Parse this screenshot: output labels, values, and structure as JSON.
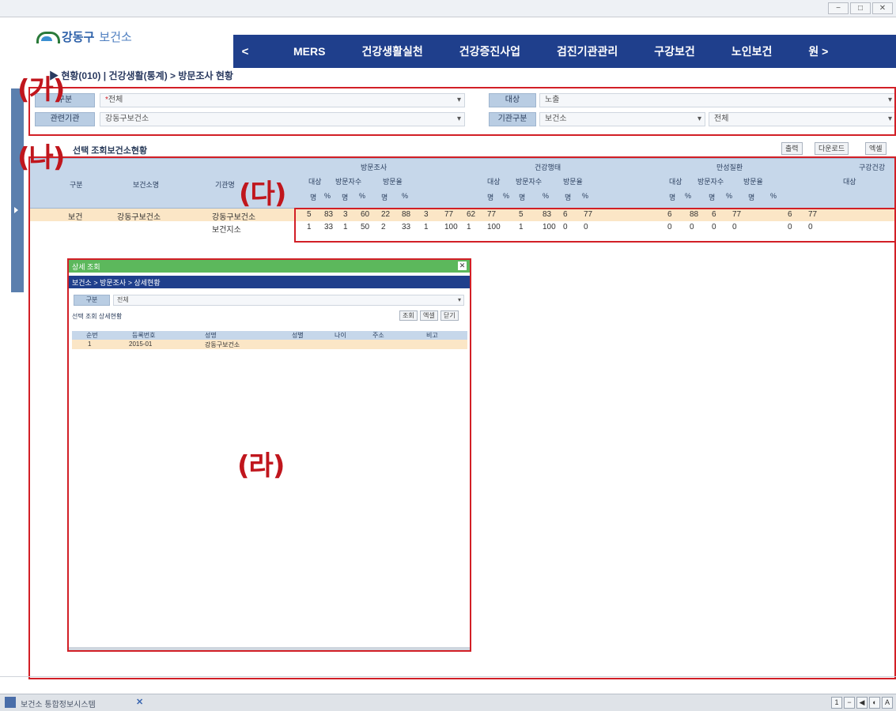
{
  "window": {
    "controls": [
      "−",
      "□",
      "✕"
    ]
  },
  "header": {
    "logo_text": "강동구",
    "logo_sub": "보건소",
    "nav_prev": "<",
    "nav_next": "원 >",
    "nav_items": [
      "MERS",
      "건강생활실천",
      "건강증진사업",
      "검진기관관리",
      "구강보건",
      "노인보건"
    ]
  },
  "breadcrumb": "▶ 현황(010) | 건강생활(통계) > 방문조사 현황",
  "annotations": {
    "ga": "(가)",
    "na": "(나)",
    "da": "(다)",
    "ra": "(라)"
  },
  "filter": {
    "row1": {
      "label1": "구분",
      "value1": "전체",
      "label2": "대상",
      "value2": "노출"
    },
    "row2": {
      "label1": "관련기관",
      "value1": "강동구보건소",
      "label2": "기관구분",
      "value2": "보건소",
      "value3": "전체"
    }
  },
  "toolbar": {
    "title": "선택 조회보건소현황",
    "buttons": [
      "출력",
      "다운로드",
      "엑셀"
    ]
  },
  "table": {
    "header_cols": [
      "구분",
      "보건소명",
      "기관명"
    ],
    "group_headers": [
      "방문조사",
      "건강행태",
      "만성질환",
      "구강건강"
    ],
    "sub_headers": [
      "대상",
      "방문자수",
      "방문율"
    ],
    "unit_header": [
      "명",
      "%"
    ],
    "rows": [
      {
        "category": "보건",
        "name": "강동구보건소",
        "org": "강동구보건소",
        "values": [
          "5",
          "83",
          "3",
          "60",
          "22",
          "88",
          "3",
          "77",
          "62",
          "77",
          "5",
          "83",
          "6",
          "77",
          "6",
          "88",
          "6",
          "77",
          "6",
          "77"
        ]
      },
      {
        "category": "",
        "name": "",
        "org": "보건지소",
        "values": [
          "1",
          "33",
          "1",
          "50",
          "2",
          "33",
          "1",
          "100",
          "1",
          "100",
          "1",
          "100",
          "0",
          "0",
          "0",
          "0",
          "0",
          "0",
          "0",
          "0"
        ]
      }
    ]
  },
  "popup": {
    "title": "상세 조회",
    "header": "보건소 > 방문조사 > 상세현황",
    "label": "구분",
    "select": "전체",
    "tool_title": "선택 조회 상세현황",
    "buttons": [
      "조회",
      "엑셀",
      "닫기"
    ],
    "columns": [
      "순번",
      "등록번호",
      "성명",
      "성별",
      "나이",
      "주소",
      "비고"
    ],
    "row": [
      "1",
      "2015-01",
      "강동구보건소",
      "",
      "",
      "",
      ""
    ]
  },
  "statusbar": {
    "tab_text": "보건소 통합정보시스템",
    "tab_close": "✕",
    "zoom_buttons": [
      "1",
      "−",
      "◀",
      "◐",
      "A"
    ]
  }
}
